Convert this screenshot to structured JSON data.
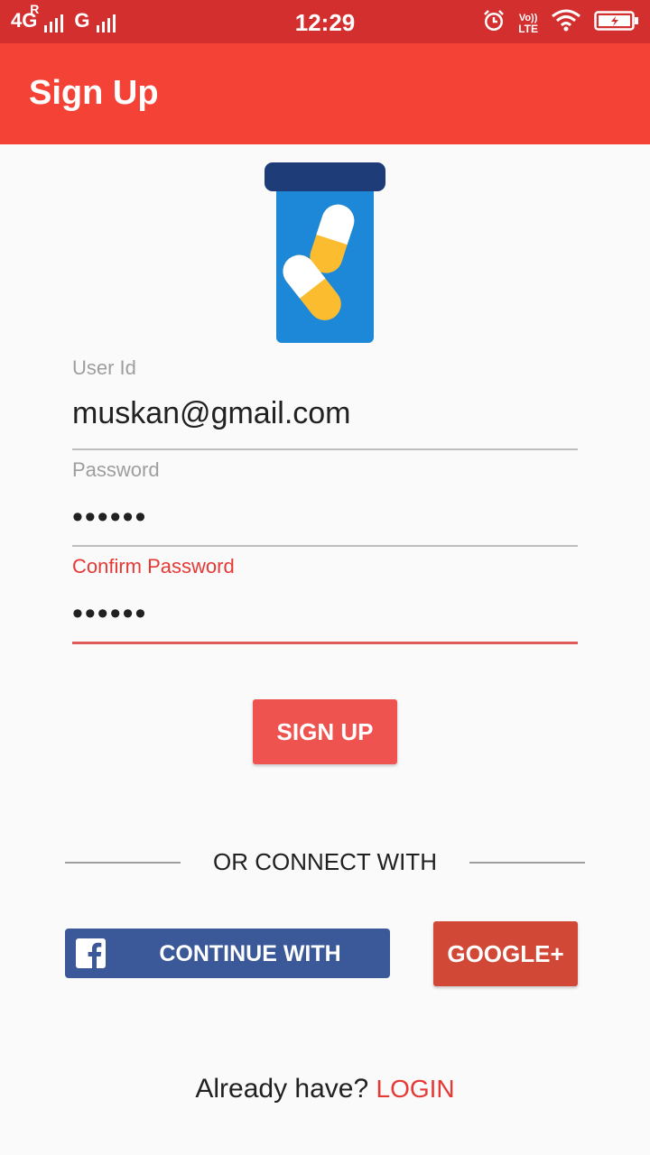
{
  "status_bar": {
    "network_1": "4G",
    "roaming": "R",
    "network_2": "G",
    "time": "12:29",
    "volte_top": "Vo))",
    "volte_bottom": "LTE",
    "icons": [
      "alarm-icon",
      "wifi-icon",
      "battery-charging-icon"
    ]
  },
  "app_bar": {
    "title": "Sign Up"
  },
  "logo": {
    "icon": "pill-bottle-icon",
    "colors": {
      "cap": "#1e3c78",
      "bottle": "#1e88d8",
      "capsule": "#fbbd2f"
    }
  },
  "form": {
    "user_id": {
      "label": "User Id",
      "value": "muskan@gmail.com"
    },
    "password": {
      "label": "Password",
      "value": "••••••"
    },
    "confirm_password": {
      "label": "Confirm Password",
      "value": "••••••"
    }
  },
  "signup_button": {
    "label": "SIGN UP"
  },
  "divider": {
    "label": "OR CONNECT WITH"
  },
  "social": {
    "facebook": {
      "label": "CONTINUE WITH",
      "icon": "facebook-icon"
    },
    "google": {
      "label": "GOOGLE+"
    }
  },
  "footer": {
    "prompt": "Already have?",
    "login": "LOGIN"
  },
  "colors": {
    "status_bar": "#d32f2f",
    "app_bar": "#f44336",
    "accent": "#e53935",
    "signup_button": "#ef5350",
    "facebook": "#3b5998",
    "google": "#d14836"
  }
}
